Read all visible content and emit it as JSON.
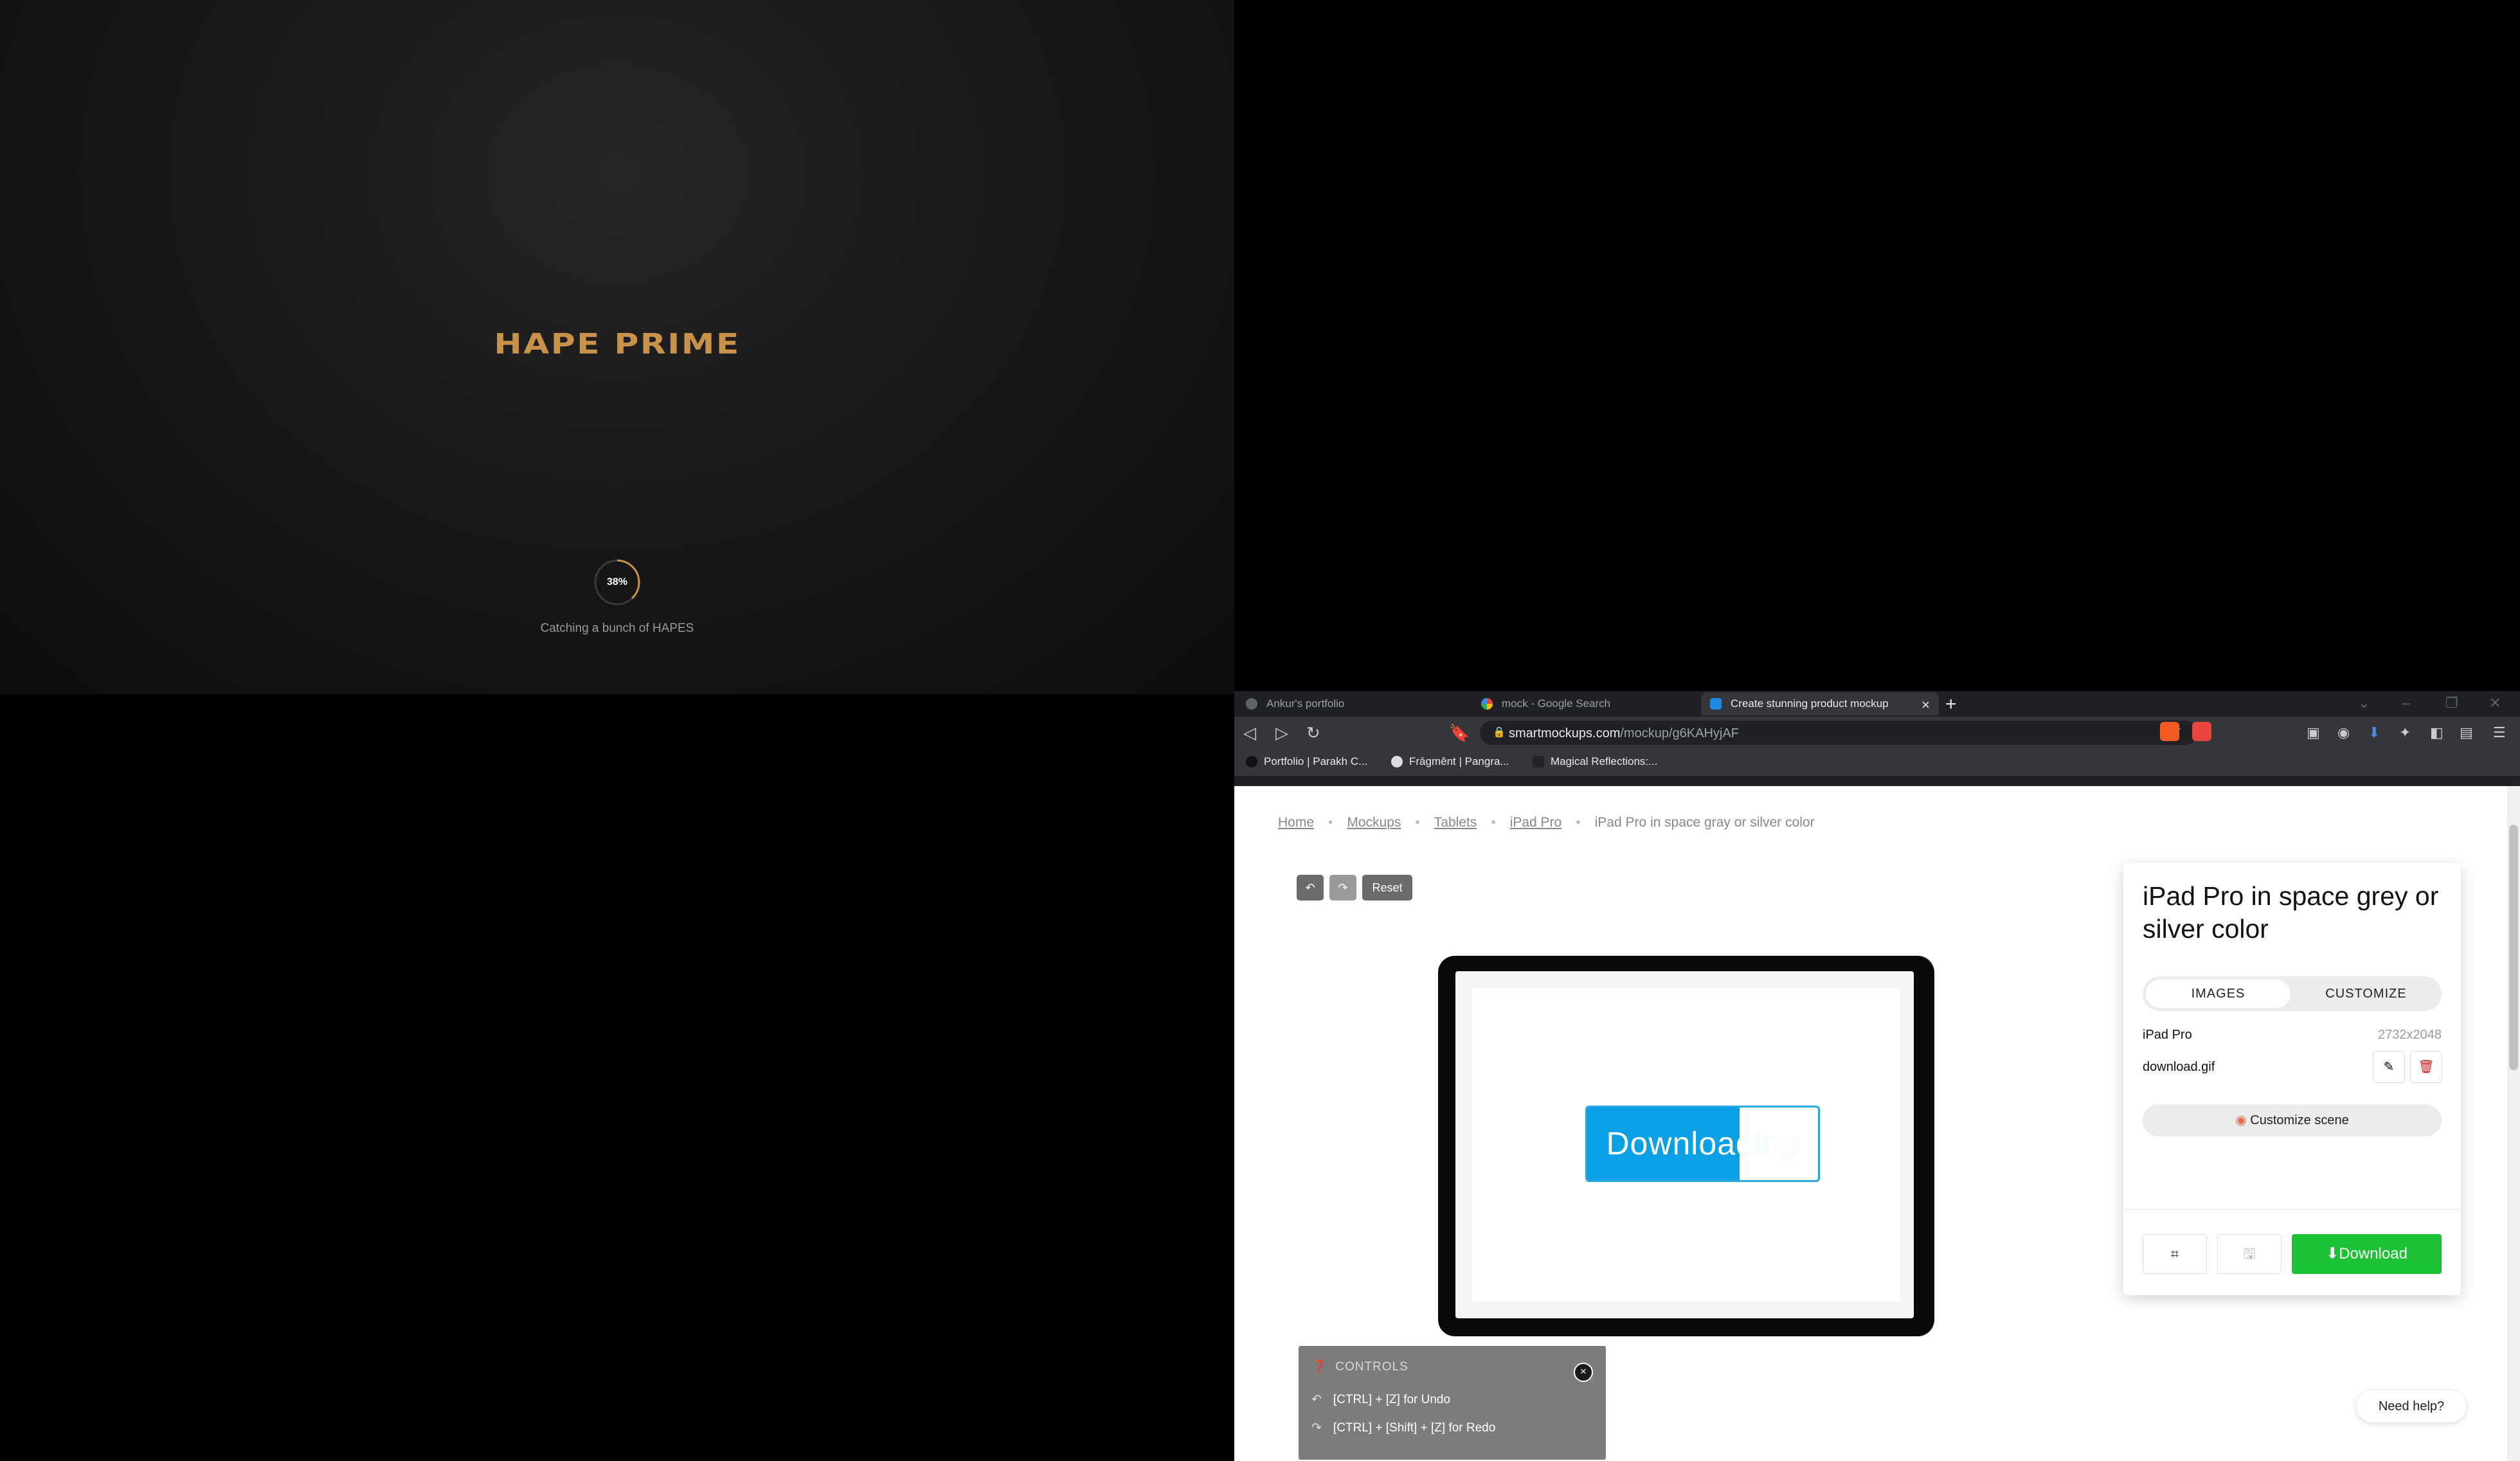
{
  "hape": {
    "logo": "HAPE PRIME",
    "progress_label": "38%",
    "progress": 0.38,
    "status": "Catching a bunch of HAPES",
    "accent_color": "#c8924a"
  },
  "browser": {
    "tabs": [
      {
        "title": "Ankur's portfolio",
        "icon": "globe-icon"
      },
      {
        "title": "mock - Google Search",
        "icon": "google-icon"
      },
      {
        "title": "Create stunning product mockup",
        "icon": "smartmockups-icon",
        "active": true
      }
    ],
    "new_tab": "+",
    "close_tab": "×",
    "url_domain": "smartmockups.com",
    "url_path": "/mockup/g6KAHyjAF",
    "bookmarks": [
      {
        "label": "Portfolio | Parakh C...",
        "icon": "bookmark-favicon"
      },
      {
        "label": "Frāgmênt | Pangra...",
        "icon": "fragment-favicon"
      },
      {
        "label": "Magical Reflections:...",
        "icon": "page-favicon"
      }
    ]
  },
  "page": {
    "breadcrumb": [
      "Home",
      "Mockups",
      "Tablets",
      "iPad Pro"
    ],
    "breadcrumb_current": "iPad Pro in space gray or silver color",
    "reset_label": "Reset",
    "mockup_text": "Downloading",
    "mockup_progress": 0.66,
    "controls": {
      "title": "CONTROLS",
      "close": "×",
      "undo": "[CTRL] + [Z] for Undo",
      "redo": "[CTRL] + [Shift] + [Z] for Redo"
    },
    "panel": {
      "title": "iPad Pro in space grey or silver color",
      "tabs": [
        "IMAGES",
        "CUSTOMIZE"
      ],
      "device_name": "iPad Pro",
      "resolution": "2732x2048",
      "file_name": "download.gif",
      "customize_scene": "Customize scene",
      "download_label": "Download"
    },
    "need_help": "Need help?",
    "colors": {
      "download_green": "#1cc135",
      "delete_red": "#e02020"
    }
  }
}
